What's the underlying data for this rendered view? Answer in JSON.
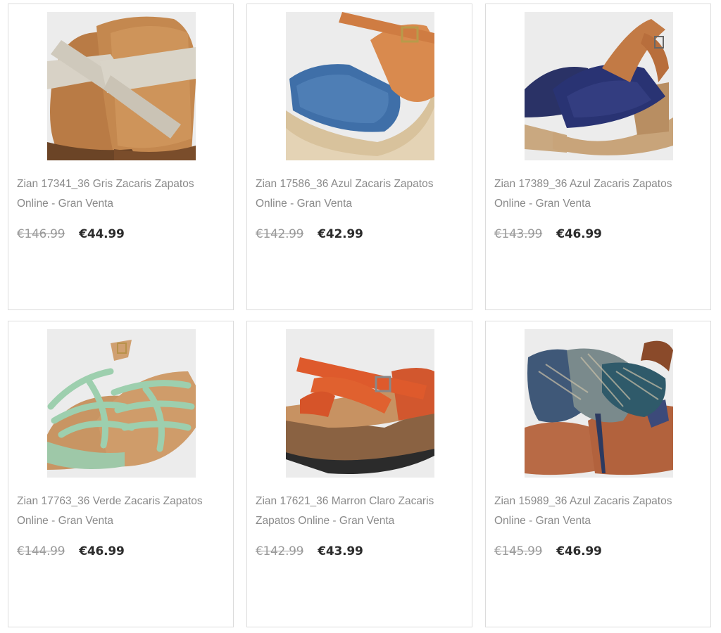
{
  "products": [
    {
      "title": "Zian 17341_36 Gris Zacaris Zapatos Online - Gran Venta",
      "old_price": "€146.99",
      "new_price": "€44.99",
      "image_icon": "sandal-beige-straps-image"
    },
    {
      "title": "Zian 17586_36 Azul Zacaris Zapatos Online - Gran Venta",
      "old_price": "€142.99",
      "new_price": "€42.99",
      "image_icon": "espadrille-denim-wedge-image"
    },
    {
      "title": "Zian 17389_36 Azul Zacaris Zapatos Online - Gran Venta",
      "old_price": "€143.99",
      "new_price": "€46.99",
      "image_icon": "sandal-navy-heel-image"
    },
    {
      "title": "Zian 17763_36 Verde Zacaris Zapatos Online - Gran Venta",
      "old_price": "€144.99",
      "new_price": "€46.99",
      "image_icon": "sandal-green-woven-image"
    },
    {
      "title": "Zian 17621_36 Marron Claro Zacaris Zapatos Online - Gran Venta",
      "old_price": "€142.99",
      "new_price": "€43.99",
      "image_icon": "sandal-orange-cork-wedge-image"
    },
    {
      "title": "Zian 15989_36 Azul Zacaris Zapatos Online - Gran Venta",
      "old_price": "€145.99",
      "new_price": "€46.99",
      "image_icon": "sandal-feather-thong-image"
    }
  ],
  "colors": {
    "border": "#dcdcdc",
    "title_text": "#8a8a8a",
    "old_price": "#9a9a9a",
    "new_price": "#2b2b2b"
  }
}
